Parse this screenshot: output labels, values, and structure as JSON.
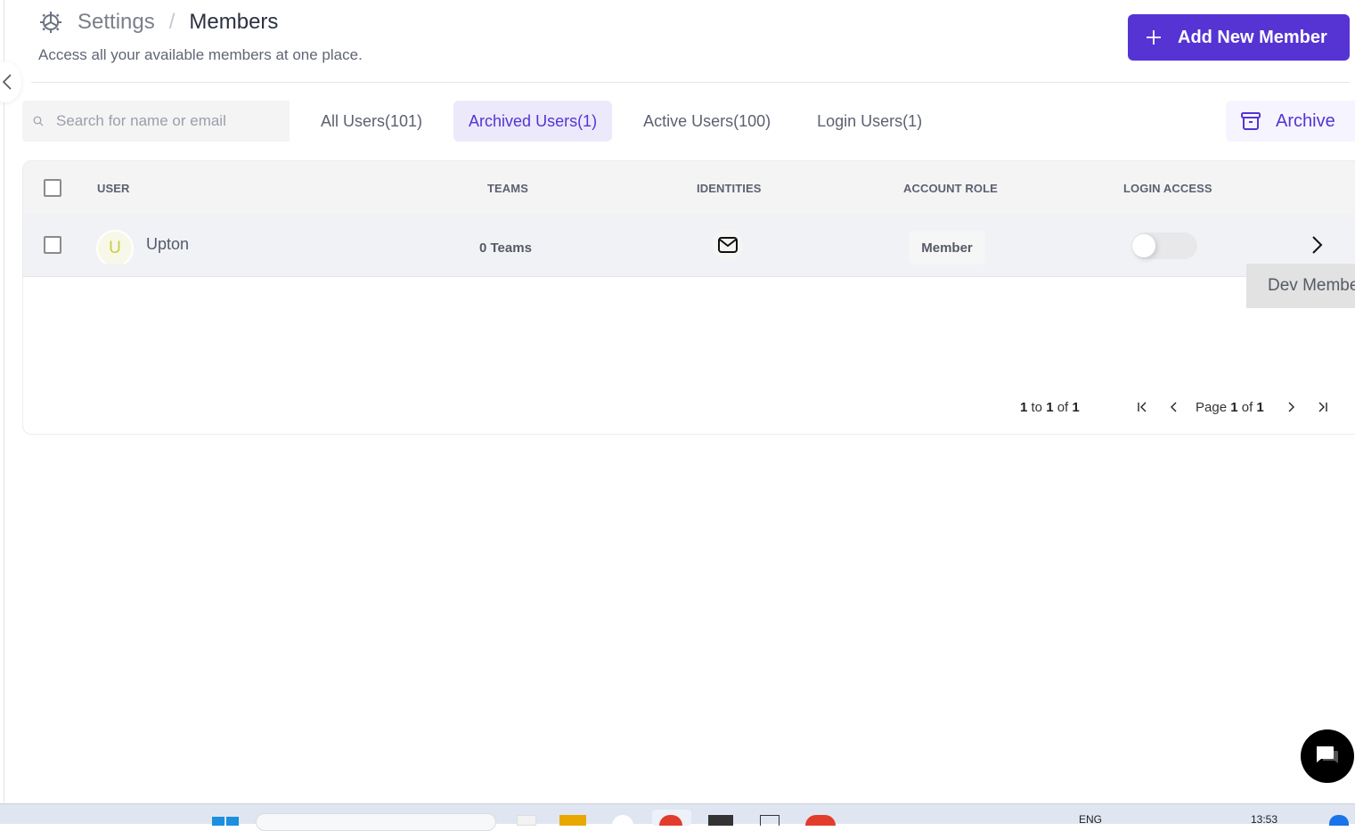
{
  "header": {
    "breadcrumb_root": "Settings",
    "breadcrumb_separator": "/",
    "breadcrumb_current": "Members",
    "subtitle": "Access all your available members at one place.",
    "root_icon": "gear-icon"
  },
  "actions": {
    "add_member_label": "Add New Member",
    "archive_label": "Archive"
  },
  "search": {
    "placeholder": "Search for name or email",
    "value": ""
  },
  "tabs": [
    {
      "label": "All Users(101)",
      "active": false
    },
    {
      "label": "Archived Users(1)",
      "active": true
    },
    {
      "label": "Active Users(100)",
      "active": false
    },
    {
      "label": "Login Users(1)",
      "active": false
    }
  ],
  "table": {
    "columns": [
      "USER",
      "TEAMS",
      "IDENTITIES",
      "ACCOUNT ROLE",
      "LOGIN ACCESS"
    ],
    "rows": [
      {
        "avatar_initial": "U",
        "name": "Upton",
        "teams": "0 Teams",
        "identity_icon": "mail-icon",
        "role": "Member",
        "login_access": false
      }
    ]
  },
  "pagination": {
    "range_start": "1",
    "range_to": "to",
    "range_end": "1",
    "range_of": "of",
    "total": "1",
    "page_label": "Page",
    "page_current": "1",
    "page_of": "of",
    "page_total": "1"
  },
  "tooltip": {
    "label": "Dev Members"
  },
  "taskbar": {
    "language": "ENG",
    "time": "13:53"
  },
  "colors": {
    "accent": "#5534d3",
    "accent_light": "#ece9fb",
    "header_bg": "#f4f4f5",
    "row_bg": "#f1f2f5"
  }
}
